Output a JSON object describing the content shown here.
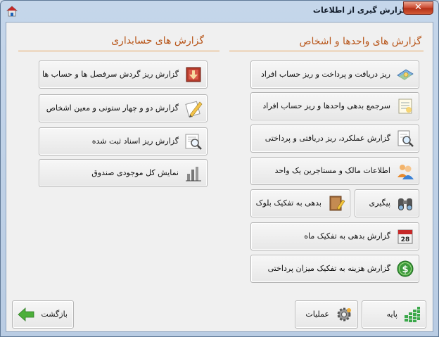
{
  "window": {
    "title": "گزارش گیری از اطلاعات",
    "close_label": "✕"
  },
  "right_section": {
    "title": "گزارش های واحدها و اشخاص",
    "buttons": [
      {
        "label": "ریز دریافت و پرداخت و ریز حساب افراد",
        "icon": "money-map-icon"
      },
      {
        "label": "سرجمع بدهی واحدها و ریز حساب افراد",
        "icon": "document-list-icon"
      },
      {
        "label": "گزارش عملکرد، ریز دریافتی و پرداختی",
        "icon": "report-magnifier-icon"
      },
      {
        "label": "اطلاعات مالک و مستاجرین یک واحد",
        "icon": "users-icon"
      },
      {
        "label": "پیگیری",
        "icon": "binoculars-icon"
      },
      {
        "label": "بدهی به تفکیک بلوک",
        "icon": "notebook-pencil-icon"
      },
      {
        "label": "گزارش بدهی به تفکیک ماه",
        "icon": "calendar-icon"
      },
      {
        "label": "گزارش هزینه به تفکیک میزان پرداختی",
        "icon": "dollar-coin-icon"
      }
    ]
  },
  "left_section": {
    "title": "گزارش های حسابداری",
    "buttons": [
      {
        "label": "گزارش ریز گردش سرفصل ها و حساب ها",
        "icon": "download-box-icon"
      },
      {
        "label": "گزارش دو و چهار ستونی و معین اشخاص",
        "icon": "pencil-paper-icon"
      },
      {
        "label": "گزارش ریز اسناد ثبت شده",
        "icon": "document-search-icon"
      },
      {
        "label": "نمایش کل موجودی صندوق",
        "icon": "bar-chart-icon"
      }
    ]
  },
  "footer": {
    "base_label": "پایه",
    "operations_label": "عملیات",
    "back_label": "بازگشت"
  },
  "colors": {
    "section_title": "#b8561a",
    "section_line": "#e5a45e"
  }
}
